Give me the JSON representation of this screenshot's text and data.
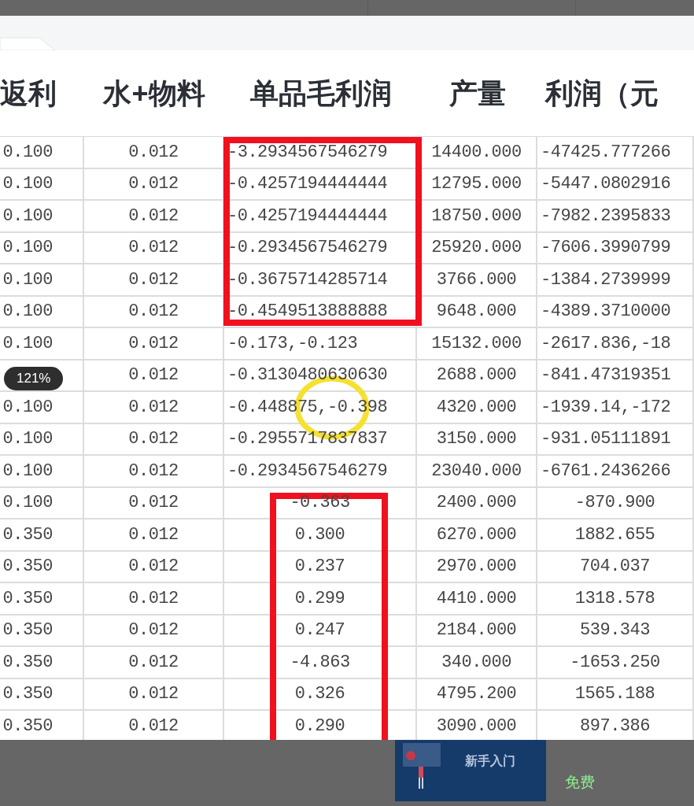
{
  "table": {
    "columns": [
      "返利",
      "水+物料",
      "单品毛利润",
      "产量",
      "利润（元"
    ],
    "rows": [
      [
        "0.100",
        "0.012",
        "-3.2934567546279",
        "14400.000",
        "-47425.777266"
      ],
      [
        "0.100",
        "0.012",
        "-0.4257194444444",
        "12795.000",
        "-5447.0802916"
      ],
      [
        "0.100",
        "0.012",
        "-0.4257194444444",
        "18750.000",
        "-7982.2395833"
      ],
      [
        "0.100",
        "0.012",
        "-0.2934567546279",
        "25920.000",
        "-7606.3990799"
      ],
      [
        "0.100",
        "0.012",
        "-0.3675714285714",
        "3766.000",
        "-1384.2739999"
      ],
      [
        "0.100",
        "0.012",
        "-0.4549513888888",
        "9648.000",
        "-4389.3710000"
      ],
      [
        "0.100",
        "0.012",
        "-0.173,-0.123",
        "15132.000",
        "-2617.836,-18"
      ],
      [
        null,
        "0.012",
        "-0.3130480630630",
        "2688.000",
        "-841.47319351"
      ],
      [
        "0.100",
        "0.012",
        "-0.448875,-0.398",
        "4320.000",
        "-1939.14,-172"
      ],
      [
        "0.100",
        "0.012",
        "-0.2955717837837",
        "3150.000",
        "-931.05111891"
      ],
      [
        "0.100",
        "0.012",
        "-0.2934567546279",
        "23040.000",
        "-6761.2436266"
      ],
      [
        "0.100",
        "0.012",
        "-0.363",
        "2400.000",
        "-870.900"
      ],
      [
        "0.350",
        "0.012",
        "0.300",
        "6270.000",
        "1882.655"
      ],
      [
        "0.350",
        "0.012",
        "0.237",
        "2970.000",
        "704.037"
      ],
      [
        "0.350",
        "0.012",
        "0.299",
        "4410.000",
        "1318.578"
      ],
      [
        "0.350",
        "0.012",
        "0.247",
        "2184.000",
        "539.343"
      ],
      [
        "0.350",
        "0.012",
        "-4.863",
        "340.000",
        "-1653.250"
      ],
      [
        "0.350",
        "0.012",
        "0.326",
        "4795.200",
        "1565.188"
      ],
      [
        "0.350",
        "0.012",
        "0.290",
        "3090.000",
        "897.386"
      ]
    ]
  },
  "annotations": [
    {
      "kind": "rectangle",
      "color": "#f0101e"
    },
    {
      "kind": "ellipse",
      "color": "#f5e130"
    },
    {
      "kind": "rectangle",
      "color": "#f0101e"
    }
  ],
  "zoom_badge": "121%",
  "background_card": {
    "thumbnail_title": "新手入门",
    "price": "免费"
  }
}
